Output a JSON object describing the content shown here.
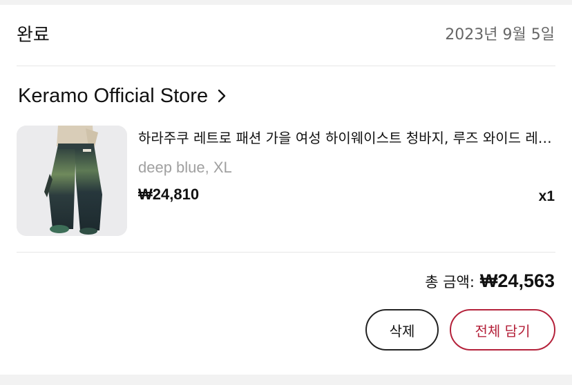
{
  "order": {
    "status": "완료",
    "date": "2023년 9월 5일"
  },
  "store": {
    "name": "Keramo Official Store",
    "chevron_icon": "chevron-right-icon"
  },
  "item": {
    "title": "하라주쿠 레트로 패션 가을 여성 하이웨이스트 청바지, 루즈 와이드 레그 팬츠",
    "variant": "deep blue, XL",
    "price": "₩24,810",
    "quantity": "x1",
    "image_icon": "product-photo-jeans"
  },
  "summary": {
    "total_label": "총 금액:",
    "total_value": "₩24,563"
  },
  "actions": {
    "delete_label": "삭제",
    "add_all_label": "전체 담기"
  },
  "colors": {
    "accent": "#b4213a",
    "muted_text": "#a0a0a0",
    "divider": "#e6e6e6"
  }
}
